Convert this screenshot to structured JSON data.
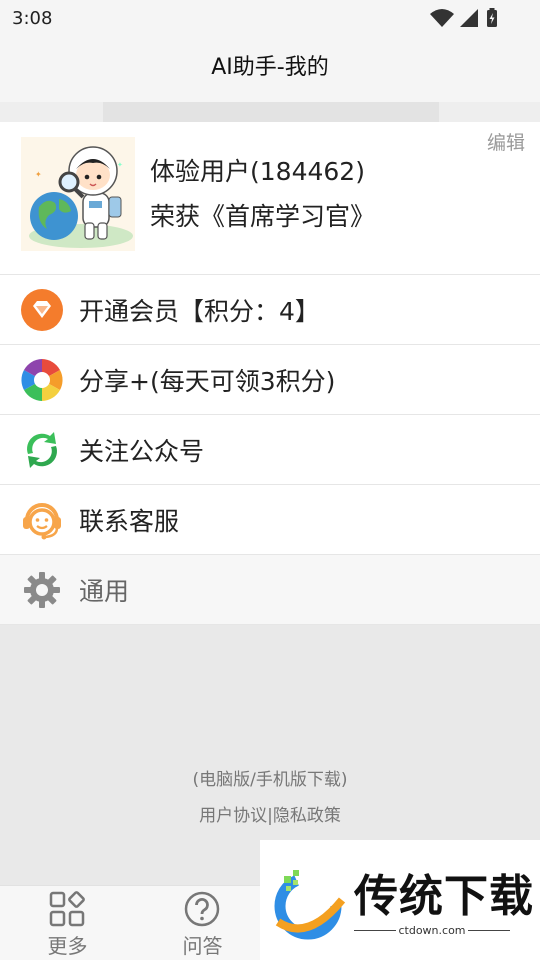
{
  "status_bar": {
    "time": "3:08"
  },
  "header": {
    "title": "AI助手-我的"
  },
  "profile": {
    "name": "体验用户(184462)",
    "honor": "荣获《首席学习官》",
    "edit_label": "编辑"
  },
  "menu": {
    "items": [
      {
        "label": "开通会员【积分：4】",
        "icon": "diamond-icon"
      },
      {
        "label": "分享+(每天可领3积分)",
        "icon": "share-aperture-icon"
      },
      {
        "label": "关注公众号",
        "icon": "official-account-icon"
      },
      {
        "label": "联系客服",
        "icon": "customer-service-icon"
      },
      {
        "label": "通用",
        "icon": "gear-icon"
      }
    ]
  },
  "footer": {
    "download_label": "(电脑版/手机版下载)",
    "agreement_label": "用户协议",
    "separator": "|",
    "privacy_label": "隐私政策"
  },
  "tabs": [
    {
      "label": "更多",
      "icon": "grid-icon"
    },
    {
      "label": "问答",
      "icon": "question-icon"
    }
  ],
  "watermark": {
    "brand": "传统下载",
    "url": "ctdown.com"
  },
  "colors": {
    "accent_orange": "#f47c2c",
    "green": "#3bbf5a",
    "service_orange": "#f7a54a"
  }
}
